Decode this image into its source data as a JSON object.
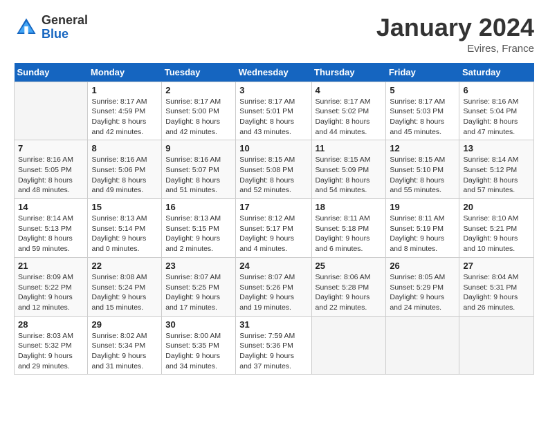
{
  "header": {
    "logo_general": "General",
    "logo_blue": "Blue",
    "title": "January 2024",
    "subtitle": "Evires, France"
  },
  "days_of_week": [
    "Sunday",
    "Monday",
    "Tuesday",
    "Wednesday",
    "Thursday",
    "Friday",
    "Saturday"
  ],
  "weeks": [
    [
      {
        "day": "",
        "sunrise": "",
        "sunset": "",
        "daylight": ""
      },
      {
        "day": "1",
        "sunrise": "Sunrise: 8:17 AM",
        "sunset": "Sunset: 4:59 PM",
        "daylight": "Daylight: 8 hours and 42 minutes."
      },
      {
        "day": "2",
        "sunrise": "Sunrise: 8:17 AM",
        "sunset": "Sunset: 5:00 PM",
        "daylight": "Daylight: 8 hours and 42 minutes."
      },
      {
        "day": "3",
        "sunrise": "Sunrise: 8:17 AM",
        "sunset": "Sunset: 5:01 PM",
        "daylight": "Daylight: 8 hours and 43 minutes."
      },
      {
        "day": "4",
        "sunrise": "Sunrise: 8:17 AM",
        "sunset": "Sunset: 5:02 PM",
        "daylight": "Daylight: 8 hours and 44 minutes."
      },
      {
        "day": "5",
        "sunrise": "Sunrise: 8:17 AM",
        "sunset": "Sunset: 5:03 PM",
        "daylight": "Daylight: 8 hours and 45 minutes."
      },
      {
        "day": "6",
        "sunrise": "Sunrise: 8:16 AM",
        "sunset": "Sunset: 5:04 PM",
        "daylight": "Daylight: 8 hours and 47 minutes."
      }
    ],
    [
      {
        "day": "7",
        "sunrise": "Sunrise: 8:16 AM",
        "sunset": "Sunset: 5:05 PM",
        "daylight": "Daylight: 8 hours and 48 minutes."
      },
      {
        "day": "8",
        "sunrise": "Sunrise: 8:16 AM",
        "sunset": "Sunset: 5:06 PM",
        "daylight": "Daylight: 8 hours and 49 minutes."
      },
      {
        "day": "9",
        "sunrise": "Sunrise: 8:16 AM",
        "sunset": "Sunset: 5:07 PM",
        "daylight": "Daylight: 8 hours and 51 minutes."
      },
      {
        "day": "10",
        "sunrise": "Sunrise: 8:15 AM",
        "sunset": "Sunset: 5:08 PM",
        "daylight": "Daylight: 8 hours and 52 minutes."
      },
      {
        "day": "11",
        "sunrise": "Sunrise: 8:15 AM",
        "sunset": "Sunset: 5:09 PM",
        "daylight": "Daylight: 8 hours and 54 minutes."
      },
      {
        "day": "12",
        "sunrise": "Sunrise: 8:15 AM",
        "sunset": "Sunset: 5:10 PM",
        "daylight": "Daylight: 8 hours and 55 minutes."
      },
      {
        "day": "13",
        "sunrise": "Sunrise: 8:14 AM",
        "sunset": "Sunset: 5:12 PM",
        "daylight": "Daylight: 8 hours and 57 minutes."
      }
    ],
    [
      {
        "day": "14",
        "sunrise": "Sunrise: 8:14 AM",
        "sunset": "Sunset: 5:13 PM",
        "daylight": "Daylight: 8 hours and 59 minutes."
      },
      {
        "day": "15",
        "sunrise": "Sunrise: 8:13 AM",
        "sunset": "Sunset: 5:14 PM",
        "daylight": "Daylight: 9 hours and 0 minutes."
      },
      {
        "day": "16",
        "sunrise": "Sunrise: 8:13 AM",
        "sunset": "Sunset: 5:15 PM",
        "daylight": "Daylight: 9 hours and 2 minutes."
      },
      {
        "day": "17",
        "sunrise": "Sunrise: 8:12 AM",
        "sunset": "Sunset: 5:17 PM",
        "daylight": "Daylight: 9 hours and 4 minutes."
      },
      {
        "day": "18",
        "sunrise": "Sunrise: 8:11 AM",
        "sunset": "Sunset: 5:18 PM",
        "daylight": "Daylight: 9 hours and 6 minutes."
      },
      {
        "day": "19",
        "sunrise": "Sunrise: 8:11 AM",
        "sunset": "Sunset: 5:19 PM",
        "daylight": "Daylight: 9 hours and 8 minutes."
      },
      {
        "day": "20",
        "sunrise": "Sunrise: 8:10 AM",
        "sunset": "Sunset: 5:21 PM",
        "daylight": "Daylight: 9 hours and 10 minutes."
      }
    ],
    [
      {
        "day": "21",
        "sunrise": "Sunrise: 8:09 AM",
        "sunset": "Sunset: 5:22 PM",
        "daylight": "Daylight: 9 hours and 12 minutes."
      },
      {
        "day": "22",
        "sunrise": "Sunrise: 8:08 AM",
        "sunset": "Sunset: 5:24 PM",
        "daylight": "Daylight: 9 hours and 15 minutes."
      },
      {
        "day": "23",
        "sunrise": "Sunrise: 8:07 AM",
        "sunset": "Sunset: 5:25 PM",
        "daylight": "Daylight: 9 hours and 17 minutes."
      },
      {
        "day": "24",
        "sunrise": "Sunrise: 8:07 AM",
        "sunset": "Sunset: 5:26 PM",
        "daylight": "Daylight: 9 hours and 19 minutes."
      },
      {
        "day": "25",
        "sunrise": "Sunrise: 8:06 AM",
        "sunset": "Sunset: 5:28 PM",
        "daylight": "Daylight: 9 hours and 22 minutes."
      },
      {
        "day": "26",
        "sunrise": "Sunrise: 8:05 AM",
        "sunset": "Sunset: 5:29 PM",
        "daylight": "Daylight: 9 hours and 24 minutes."
      },
      {
        "day": "27",
        "sunrise": "Sunrise: 8:04 AM",
        "sunset": "Sunset: 5:31 PM",
        "daylight": "Daylight: 9 hours and 26 minutes."
      }
    ],
    [
      {
        "day": "28",
        "sunrise": "Sunrise: 8:03 AM",
        "sunset": "Sunset: 5:32 PM",
        "daylight": "Daylight: 9 hours and 29 minutes."
      },
      {
        "day": "29",
        "sunrise": "Sunrise: 8:02 AM",
        "sunset": "Sunset: 5:34 PM",
        "daylight": "Daylight: 9 hours and 31 minutes."
      },
      {
        "day": "30",
        "sunrise": "Sunrise: 8:00 AM",
        "sunset": "Sunset: 5:35 PM",
        "daylight": "Daylight: 9 hours and 34 minutes."
      },
      {
        "day": "31",
        "sunrise": "Sunrise: 7:59 AM",
        "sunset": "Sunset: 5:36 PM",
        "daylight": "Daylight: 9 hours and 37 minutes."
      },
      {
        "day": "",
        "sunrise": "",
        "sunset": "",
        "daylight": ""
      },
      {
        "day": "",
        "sunrise": "",
        "sunset": "",
        "daylight": ""
      },
      {
        "day": "",
        "sunrise": "",
        "sunset": "",
        "daylight": ""
      }
    ]
  ]
}
